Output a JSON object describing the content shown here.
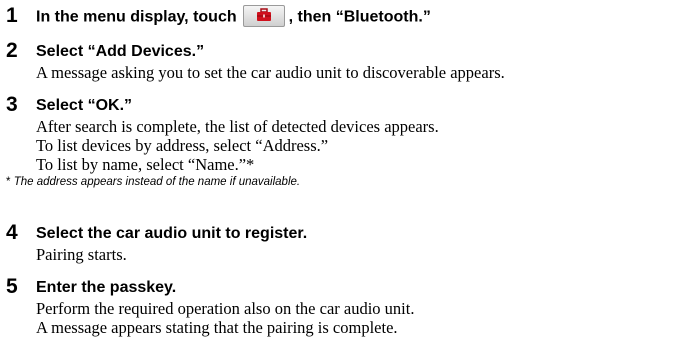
{
  "steps": [
    {
      "number": "1",
      "heading_before": "In the menu display, touch",
      "icon": "toolbox-icon",
      "heading_after": ", then “Bluetooth.”",
      "lines": []
    },
    {
      "number": "2",
      "heading": "Select “Add Devices.”",
      "lines": [
        "A message asking you to set the car audio unit to discoverable appears."
      ]
    },
    {
      "number": "3",
      "heading": "Select “OK.”",
      "lines": [
        "After search is complete, the list of detected devices appears.",
        "To list devices by address, select “Address.”",
        "To list by name, select “Name.”*"
      ],
      "note_star": "*",
      "note": "The address appears instead of the name if unavailable."
    },
    {
      "number": "4",
      "heading": "Select the car audio unit to register.",
      "lines": [
        "Pairing starts."
      ]
    },
    {
      "number": "5",
      "heading": "Enter the passkey.",
      "lines": [
        "Perform the required operation also on the car audio unit.",
        "A message appears stating that the pairing is complete."
      ]
    }
  ],
  "colors": {
    "icon_red": "#d0101c"
  }
}
